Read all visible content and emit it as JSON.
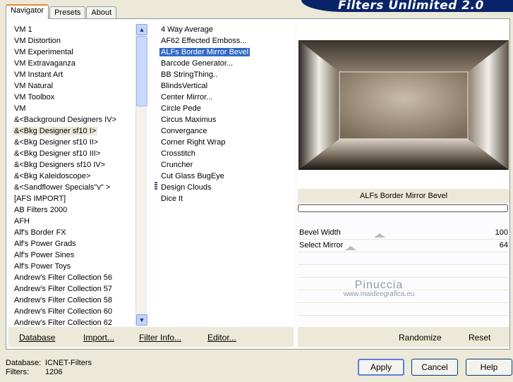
{
  "tabs": [
    "Navigator",
    "Presets",
    "About"
  ],
  "banner_title": "Filters Unlimited 2.0",
  "categories": [
    "VM 1",
    "VM Distortion",
    "VM Experimental",
    "VM Extravaganza",
    "VM Instant Art",
    "VM Natural",
    "VM Toolbox",
    "VM",
    "&<Background Designers IV>",
    "&<Bkg Designer sf10 I>",
    "&<Bkg Designer sf10 II>",
    "&<Bkg Designer sf10 III>",
    "&<Bkg Designers sf10 IV>",
    "&<Bkg Kaleidoscope>",
    "&<Sandflower Specials\"v\" >",
    "[AFS IMPORT]",
    "AB Filters 2000",
    "AFH",
    "Alf's Border FX",
    "Alf's Power Grads",
    "Alf's Power Sines",
    "Alf's Power Toys",
    "Andrew's Filter Collection 56",
    "Andrew's Filter Collection 57",
    "Andrew's Filter Collection 58",
    "Andrew's Filter Collection 60",
    "Andrew's Filter Collection 62"
  ],
  "filters": [
    "4 Way Average",
    "AF62 Effected Emboss...",
    "ALFs Border Mirror Bevel",
    "Barcode Generator...",
    "BB StringThing..",
    "BlindsVertical",
    "Center Mirror...",
    "Circle Pede",
    "Circus Maximus",
    "Convergance",
    "Corner Right Wrap",
    "Crosstitch",
    "Cruncher",
    "Cut Glass  BugEye",
    "Design Clouds",
    "Dice It"
  ],
  "selected_category_index": 9,
  "selected_filter_index": 2,
  "bottom_links": {
    "database": "Database",
    "import": "Import...",
    "filter_info": "Filter Info...",
    "editor": "Editor...",
    "randomize": "Randomize",
    "reset": "Reset"
  },
  "preview_filter_name": "ALFs Border Mirror Bevel",
  "params": [
    {
      "label": "Bevel Width",
      "value": "100"
    },
    {
      "label": "Select Mirror",
      "value": "64"
    }
  ],
  "watermark": {
    "line1": "Pinuccia",
    "line2": "www.maidiregrafica.eu"
  },
  "status": {
    "database_label": "Database:",
    "database_value": "ICNET-Filters",
    "filters_label": "Filters:",
    "filters_value": "1206"
  },
  "buttons": {
    "apply": "Apply",
    "cancel": "Cancel",
    "help": "Help"
  },
  "colors": {
    "selection": "#316ac5",
    "banner": "#0a246a",
    "dialog_bg": "#ece9d8"
  }
}
